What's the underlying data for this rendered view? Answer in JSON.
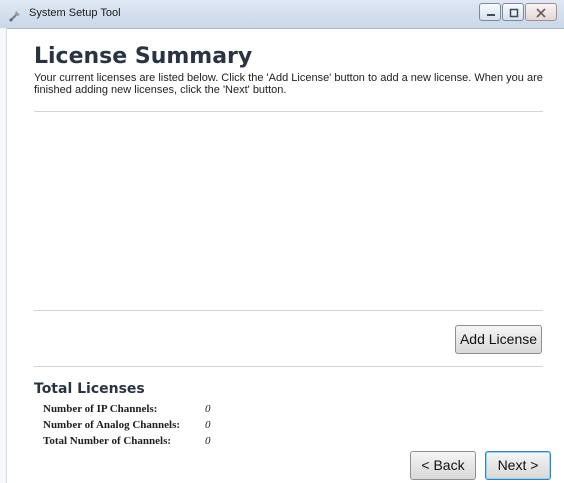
{
  "window": {
    "title": "System Setup Tool",
    "icon": "app-icon",
    "controls": [
      "minimize-icon",
      "maximize-icon",
      "close-icon"
    ]
  },
  "page": {
    "heading": "License Summary",
    "intro": "Your current licenses are listed below. Click the 'Add License' button to add a new license. When you are finished adding new licenses, click the 'Next' button."
  },
  "licenses": {
    "items": [],
    "add_label": "Add License"
  },
  "totals": {
    "heading": "Total Licenses",
    "rows": [
      {
        "label": "Number of IP Channels:",
        "value": "0"
      },
      {
        "label": "Number of Analog Channels:",
        "value": "0"
      },
      {
        "label": "Total Number of Channels:",
        "value": "0"
      }
    ]
  },
  "nav": {
    "back_label": "< Back",
    "next_label": "Next >"
  },
  "colors": {
    "heading": "#2a3440",
    "titlebar": "#c9d7e8",
    "default_button_border": "#3c7fb1"
  }
}
